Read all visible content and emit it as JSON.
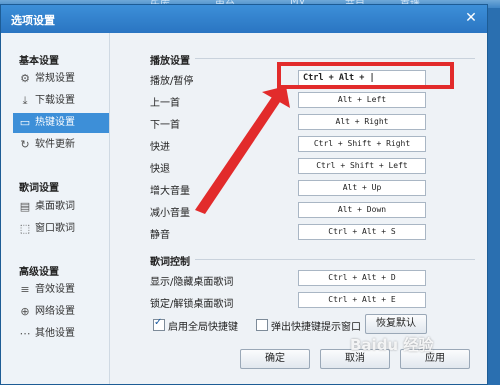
{
  "background": {
    "tabs": [
      "乐库",
      "电台",
      "MV",
      "节目",
      "直播"
    ]
  },
  "dialog": {
    "title": "选项设置",
    "close_icon": "close-icon"
  },
  "sidebar": {
    "groups": [
      {
        "title": "基本设置",
        "items": [
          {
            "label": "常规设置",
            "icon": "gear-icon"
          },
          {
            "label": "下载设置",
            "icon": "download-icon"
          },
          {
            "label": "热键设置",
            "icon": "keyboard-icon",
            "active": true
          },
          {
            "label": "软件更新",
            "icon": "update-icon"
          }
        ]
      },
      {
        "title": "歌词设置",
        "items": [
          {
            "label": "桌面歌词",
            "icon": "desktop-lyrics-icon"
          },
          {
            "label": "窗口歌词",
            "icon": "window-lyrics-icon"
          }
        ]
      },
      {
        "title": "高级设置",
        "items": [
          {
            "label": "音效设置",
            "icon": "equalizer-icon"
          },
          {
            "label": "网络设置",
            "icon": "network-icon"
          },
          {
            "label": "其他设置",
            "icon": "more-icon"
          }
        ]
      }
    ]
  },
  "playback": {
    "section_title": "播放设置",
    "rows": [
      {
        "label": "播放/暂停",
        "hotkey": "Ctrl + Alt + |"
      },
      {
        "label": "上一首",
        "hotkey": "Alt + Left"
      },
      {
        "label": "下一首",
        "hotkey": "Alt + Right"
      },
      {
        "label": "快进",
        "hotkey": "Ctrl + Shift + Right"
      },
      {
        "label": "快退",
        "hotkey": "Ctrl + Shift + Left"
      },
      {
        "label": "增大音量",
        "hotkey": "Alt + Up"
      },
      {
        "label": "减小音量",
        "hotkey": "Alt + Down"
      },
      {
        "label": "静音",
        "hotkey": "Ctrl + Alt + S"
      }
    ]
  },
  "lyrics": {
    "section_title": "歌词控制",
    "rows": [
      {
        "label": "显示/隐藏桌面歌词",
        "hotkey": "Ctrl + Alt + D"
      },
      {
        "label": "锁定/解锁桌面歌词",
        "hotkey": "Ctrl + Alt + E"
      }
    ]
  },
  "options": {
    "global_hotkeys": {
      "label": "启用全局快捷键",
      "checked": true
    },
    "popup_hint": {
      "label": "弹出快捷键提示窗口",
      "checked": false
    },
    "restore_default": "恢复默认"
  },
  "footer": {
    "ok": "确定",
    "cancel": "取消",
    "apply": "应用"
  },
  "watermark": "Baidu 经验",
  "colors": {
    "accent": "#3d8fd8",
    "annotation": "#e22b2b"
  }
}
